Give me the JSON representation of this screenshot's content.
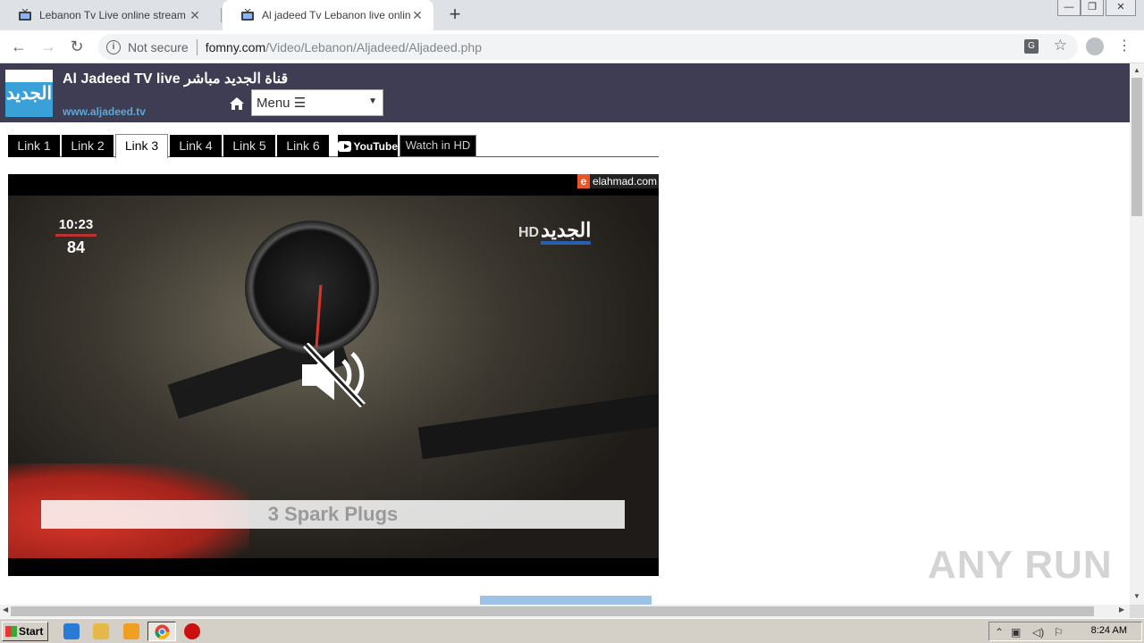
{
  "browser": {
    "tabs": [
      {
        "title": "Lebanon Tv Live online stream قنوات",
        "active": false
      },
      {
        "title": "Al jadeed Tv Lebanon live online stre",
        "active": true
      }
    ],
    "new_tab_symbol": "+",
    "window_controls": [
      "minimize",
      "restore",
      "close"
    ],
    "security_label": "Not secure",
    "url_domain": "fomny.com",
    "url_path": "/Video/Lebanon/Aljadeed/Aljadeed.php"
  },
  "site": {
    "title": "Al Jadeed TV live قناة الجديد مباشر",
    "url": "www.aljadeed.tv",
    "logo_text": "الجديد",
    "menu_label": "Menu ☰"
  },
  "stream_links": [
    {
      "label": "Link 1",
      "active": false
    },
    {
      "label": "Link 2",
      "active": false
    },
    {
      "label": "Link 3",
      "active": true
    },
    {
      "label": "Link 4",
      "active": false
    },
    {
      "label": "Link 5",
      "active": false
    },
    {
      "label": "Link 6",
      "active": false
    }
  ],
  "youtube_label": "YouTube",
  "watch_hd_label": "Watch in HD",
  "player": {
    "brand": "elahmad.com",
    "brand_letter": "e",
    "osd_time": "10:23",
    "osd_number": "84",
    "channel_logo": "الجديد",
    "channel_hd": "HD",
    "caption": "3 Spark Plugs",
    "muted": true
  },
  "watermark": "ANY RUN",
  "taskbar": {
    "start_label": "Start",
    "clock": "8:24 AM",
    "pinned": [
      "internet-explorer",
      "file-explorer",
      "media-player",
      "chrome",
      "opera"
    ]
  }
}
